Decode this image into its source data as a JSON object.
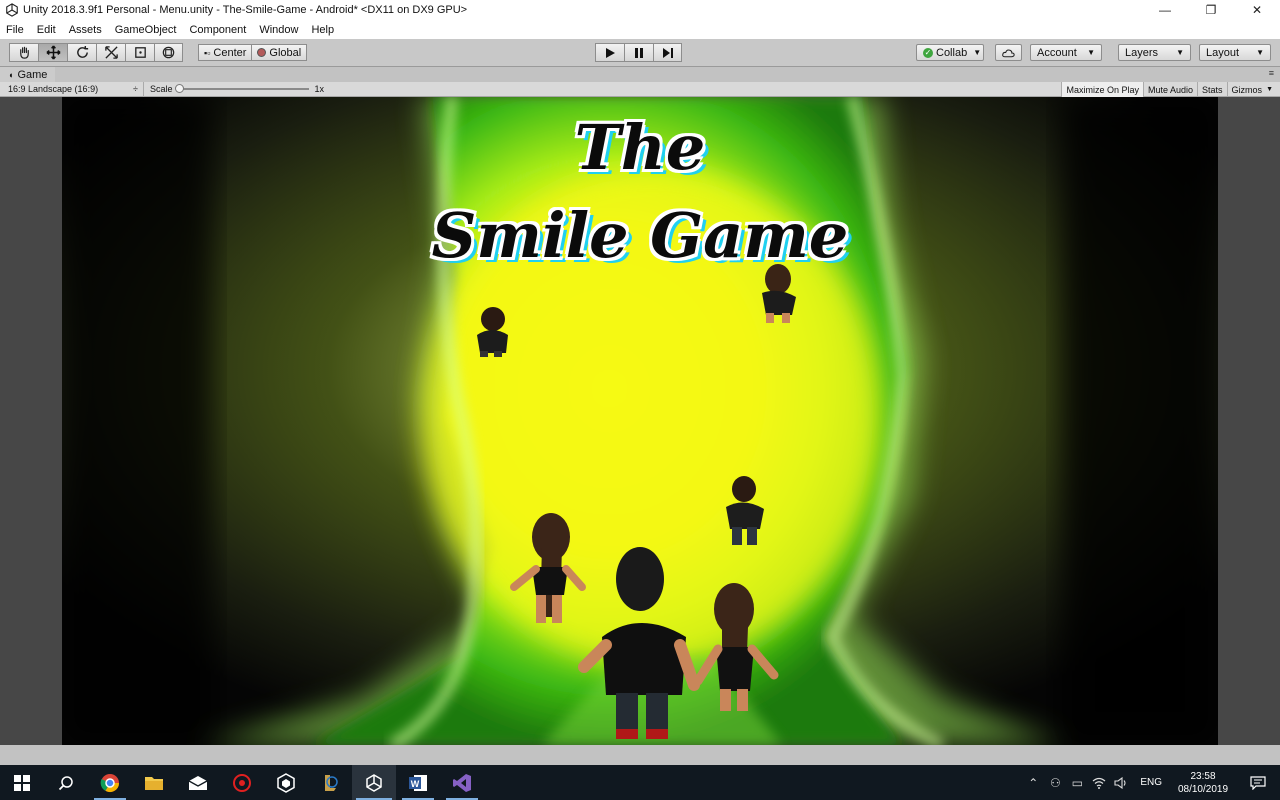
{
  "window": {
    "title": "Unity 2018.3.9f1 Personal - Menu.unity - The-Smile-Game - Android* <DX11 on DX9 GPU>",
    "minimize": "—",
    "maximize": "❐",
    "close": "✕"
  },
  "menu": {
    "items": [
      "File",
      "Edit",
      "Assets",
      "GameObject",
      "Component",
      "Window",
      "Help"
    ]
  },
  "toolbar": {
    "tools": [
      "hand-tool",
      "move-tool",
      "rotate-tool",
      "scale-tool",
      "rect-tool",
      "transform-tool"
    ],
    "active_tool": "move-tool",
    "pivot_label": "Center",
    "space_label": "Global",
    "collab_label": "Collab",
    "account_label": "Account",
    "layers_label": "Layers",
    "layout_label": "Layout"
  },
  "game_view": {
    "tab_label": "Game",
    "aspect_label": "16:9 Landscape (16:9)",
    "scale_label": "Scale",
    "scale_value": "1x",
    "scale_fraction": 0,
    "maximize_on_play": "Maximize On Play",
    "mute_audio": "Mute Audio",
    "stats": "Stats",
    "gizmos": "Gizmos"
  },
  "game": {
    "title_line1": "The",
    "title_line2": "Smile Game"
  },
  "taskbar": {
    "apps": [
      "windows-start",
      "search",
      "chrome",
      "file-explorer",
      "mail",
      "antivirus",
      "unity-hub",
      "league",
      "unity",
      "word",
      "visual-studio"
    ],
    "language": "ENG",
    "time": "23:58",
    "date": "08/10/2019"
  },
  "colors": {
    "portal_core": "#f4f80a",
    "portal_glow": "#5ee61a",
    "title_shadow": "#20d0f0",
    "taskbar_bg": "#101820"
  }
}
